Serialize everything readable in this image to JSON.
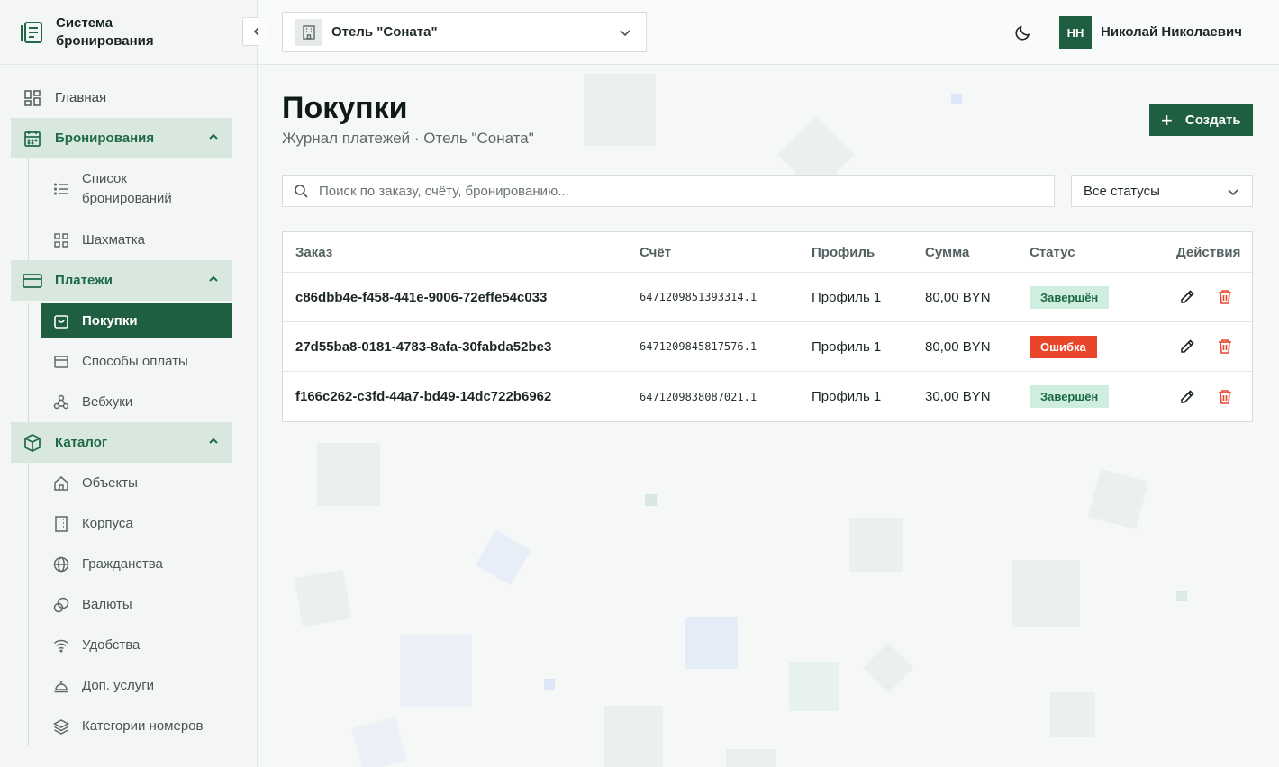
{
  "app": {
    "title": "Система бронирования"
  },
  "sidebar": {
    "home": "Главная",
    "bookings": {
      "label": "Бронирования",
      "items": [
        "Список бронирований",
        "Шахматка"
      ]
    },
    "payments": {
      "label": "Платежи",
      "items": [
        "Покупки",
        "Способы оплаты",
        "Вебхуки"
      ]
    },
    "catalog": {
      "label": "Каталог",
      "items": [
        "Объекты",
        "Корпуса",
        "Гражданства",
        "Валюты",
        "Удобства",
        "Доп. услуги",
        "Категории номеров"
      ]
    }
  },
  "header": {
    "hotel": "Отель \"Соната\"",
    "avatar_initials": "НН",
    "user_name": "Николай Николаевич"
  },
  "page": {
    "title": "Покупки",
    "subtitle": "Журнал платежей · Отель \"Соната\"",
    "create_label": "Создать",
    "search_placeholder": "Поиск по заказу, счёту, бронированию...",
    "status_filter": "Все статусы"
  },
  "table": {
    "columns": {
      "order": "Заказ",
      "invoice": "Счёт",
      "profile": "Профиль",
      "sum": "Сумма",
      "status": "Статус",
      "actions": "Действия"
    },
    "rows": [
      {
        "order": "c86dbb4e-f458-441e-9006-72effe54c033",
        "invoice": "6471209851393314.1",
        "profile": "Профиль 1",
        "sum": "80,00 BYN",
        "status": "Завершён"
      },
      {
        "order": "27d55ba8-0181-4783-8afa-30fabda52be3",
        "invoice": "6471209845817576.1",
        "profile": "Профиль 1",
        "sum": "80,00 BYN",
        "status": "Ошибка"
      },
      {
        "order": "f166c262-c3fd-44a7-bd49-14dc722b6962",
        "invoice": "6471209838087021.1",
        "profile": "Профиль 1",
        "sum": "30,00 BYN",
        "status": "Завершён"
      }
    ]
  },
  "colors": {
    "accent": "#1f5e40",
    "success_bg": "#cfeee0",
    "error": "#e8452b"
  }
}
